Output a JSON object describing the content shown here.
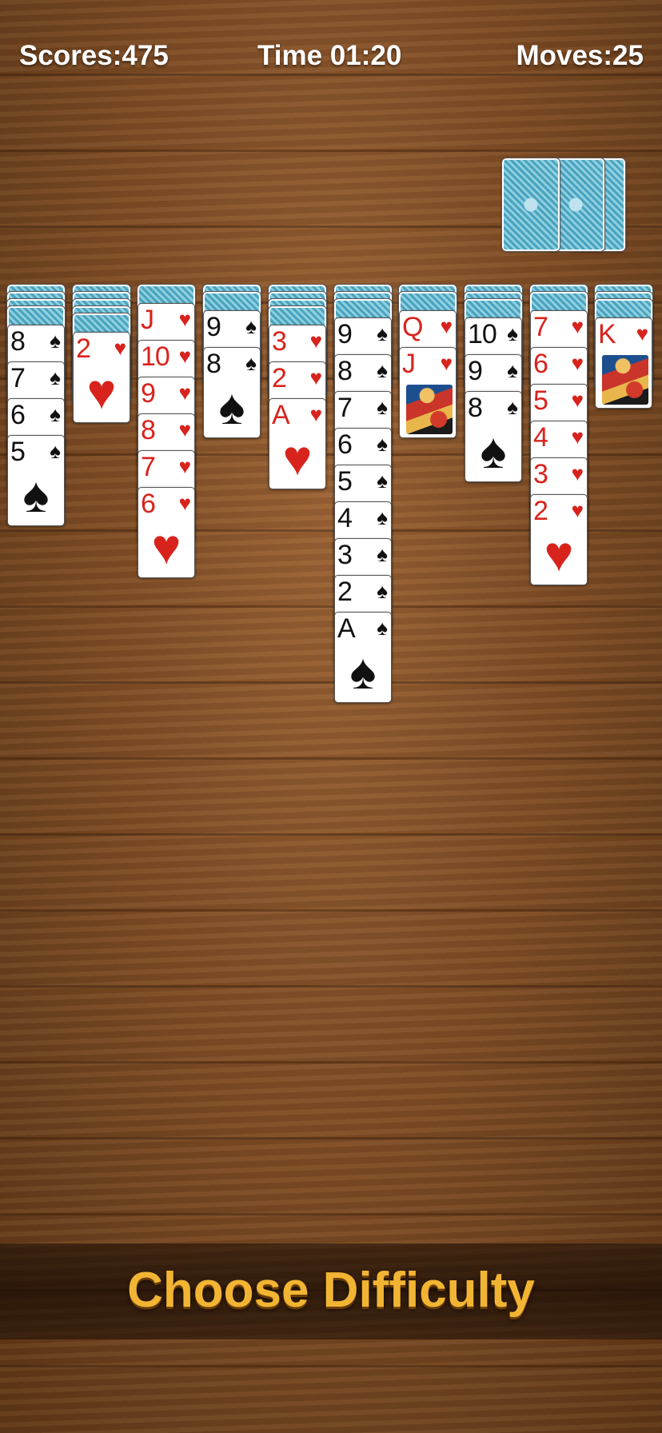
{
  "hud": {
    "scores": "Scores:475",
    "time": "Time 01:20",
    "moves": "Moves:25"
  },
  "stock": {
    "piles_remaining": 3,
    "icon": "card-back-icon"
  },
  "tableau": [
    {
      "hidden": 4,
      "cards": [
        {
          "rank": "8",
          "suit": "♠",
          "color": "black"
        },
        {
          "rank": "7",
          "suit": "♠",
          "color": "black"
        },
        {
          "rank": "6",
          "suit": "♠",
          "color": "black"
        },
        {
          "rank": "5",
          "suit": "♠",
          "color": "black"
        }
      ]
    },
    {
      "hidden": 5,
      "cards": [
        {
          "rank": "2",
          "suit": "♥",
          "color": "red"
        }
      ]
    },
    {
      "hidden": 1,
      "cards": [
        {
          "rank": "J",
          "suit": "♥",
          "color": "red"
        },
        {
          "rank": "10",
          "suit": "♥",
          "color": "red"
        },
        {
          "rank": "9",
          "suit": "♥",
          "color": "red"
        },
        {
          "rank": "8",
          "suit": "♥",
          "color": "red"
        },
        {
          "rank": "7",
          "suit": "♥",
          "color": "red"
        },
        {
          "rank": "6",
          "suit": "♥",
          "color": "red"
        }
      ]
    },
    {
      "hidden": 2,
      "cards": [
        {
          "rank": "9",
          "suit": "♠",
          "color": "black"
        },
        {
          "rank": "8",
          "suit": "♠",
          "color": "black"
        }
      ]
    },
    {
      "hidden": 4,
      "cards": [
        {
          "rank": "3",
          "suit": "♥",
          "color": "red"
        },
        {
          "rank": "2",
          "suit": "♥",
          "color": "red"
        },
        {
          "rank": "A",
          "suit": "♥",
          "color": "red"
        }
      ]
    },
    {
      "hidden": 3,
      "cards": [
        {
          "rank": "9",
          "suit": "♠",
          "color": "black"
        },
        {
          "rank": "8",
          "suit": "♠",
          "color": "black"
        },
        {
          "rank": "7",
          "suit": "♠",
          "color": "black"
        },
        {
          "rank": "6",
          "suit": "♠",
          "color": "black"
        },
        {
          "rank": "5",
          "suit": "♠",
          "color": "black"
        },
        {
          "rank": "4",
          "suit": "♠",
          "color": "black"
        },
        {
          "rank": "3",
          "suit": "♠",
          "color": "black"
        },
        {
          "rank": "2",
          "suit": "♠",
          "color": "black"
        },
        {
          "rank": "A",
          "suit": "♠",
          "color": "black"
        }
      ]
    },
    {
      "hidden": 2,
      "cards": [
        {
          "rank": "Q",
          "suit": "♥",
          "color": "red"
        },
        {
          "rank": "J",
          "suit": "♥",
          "color": "red",
          "face": true
        }
      ]
    },
    {
      "hidden": 3,
      "cards": [
        {
          "rank": "10",
          "suit": "♠",
          "color": "black"
        },
        {
          "rank": "9",
          "suit": "♠",
          "color": "black"
        },
        {
          "rank": "8",
          "suit": "♠",
          "color": "black"
        }
      ]
    },
    {
      "hidden": 2,
      "cards": [
        {
          "rank": "7",
          "suit": "♥",
          "color": "red"
        },
        {
          "rank": "6",
          "suit": "♥",
          "color": "red"
        },
        {
          "rank": "5",
          "suit": "♥",
          "color": "red"
        },
        {
          "rank": "4",
          "suit": "♥",
          "color": "red"
        },
        {
          "rank": "3",
          "suit": "♥",
          "color": "red"
        },
        {
          "rank": "2",
          "suit": "♥",
          "color": "red"
        }
      ]
    },
    {
      "hidden": 3,
      "cards": [
        {
          "rank": "K",
          "suit": "♥",
          "color": "red",
          "face": true
        }
      ]
    }
  ],
  "footer": {
    "choose_difficulty": "Choose Difficulty"
  }
}
